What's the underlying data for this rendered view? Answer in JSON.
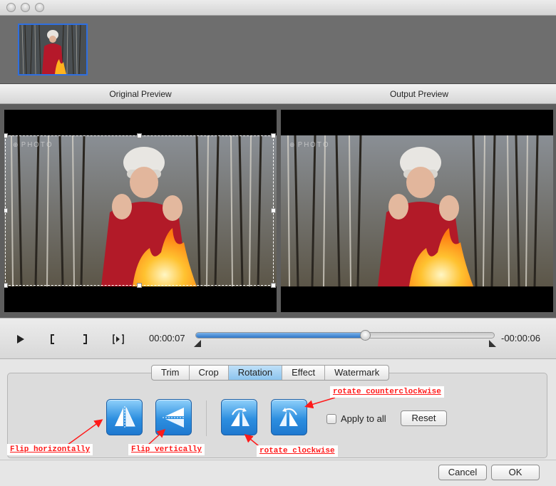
{
  "window": {
    "traffic_lights": [
      "close",
      "minimize",
      "zoom"
    ]
  },
  "preview": {
    "original_label": "Original Preview",
    "output_label": "Output Preview"
  },
  "transport": {
    "play_icon": "play-icon",
    "current_time": "00:00:07",
    "remaining_time": "-00:00:06",
    "progress": 0.57
  },
  "tabs": [
    {
      "label": "Trim",
      "active": false
    },
    {
      "label": "Crop",
      "active": false
    },
    {
      "label": "Rotation",
      "active": true
    },
    {
      "label": "Effect",
      "active": false
    },
    {
      "label": "Watermark",
      "active": false
    }
  ],
  "rotation": {
    "apply_all_label": "Apply to all",
    "apply_all_checked": false,
    "reset_label": "Reset"
  },
  "annotations": {
    "flip_h": "Flip horizontally",
    "flip_v": "Flip vertically",
    "rotate_cw": "rotate clockwise",
    "rotate_ccw": "rotate counterclockwise",
    "color": "#ff1a1a"
  },
  "footer": {
    "cancel_label": "Cancel",
    "ok_label": "OK"
  }
}
